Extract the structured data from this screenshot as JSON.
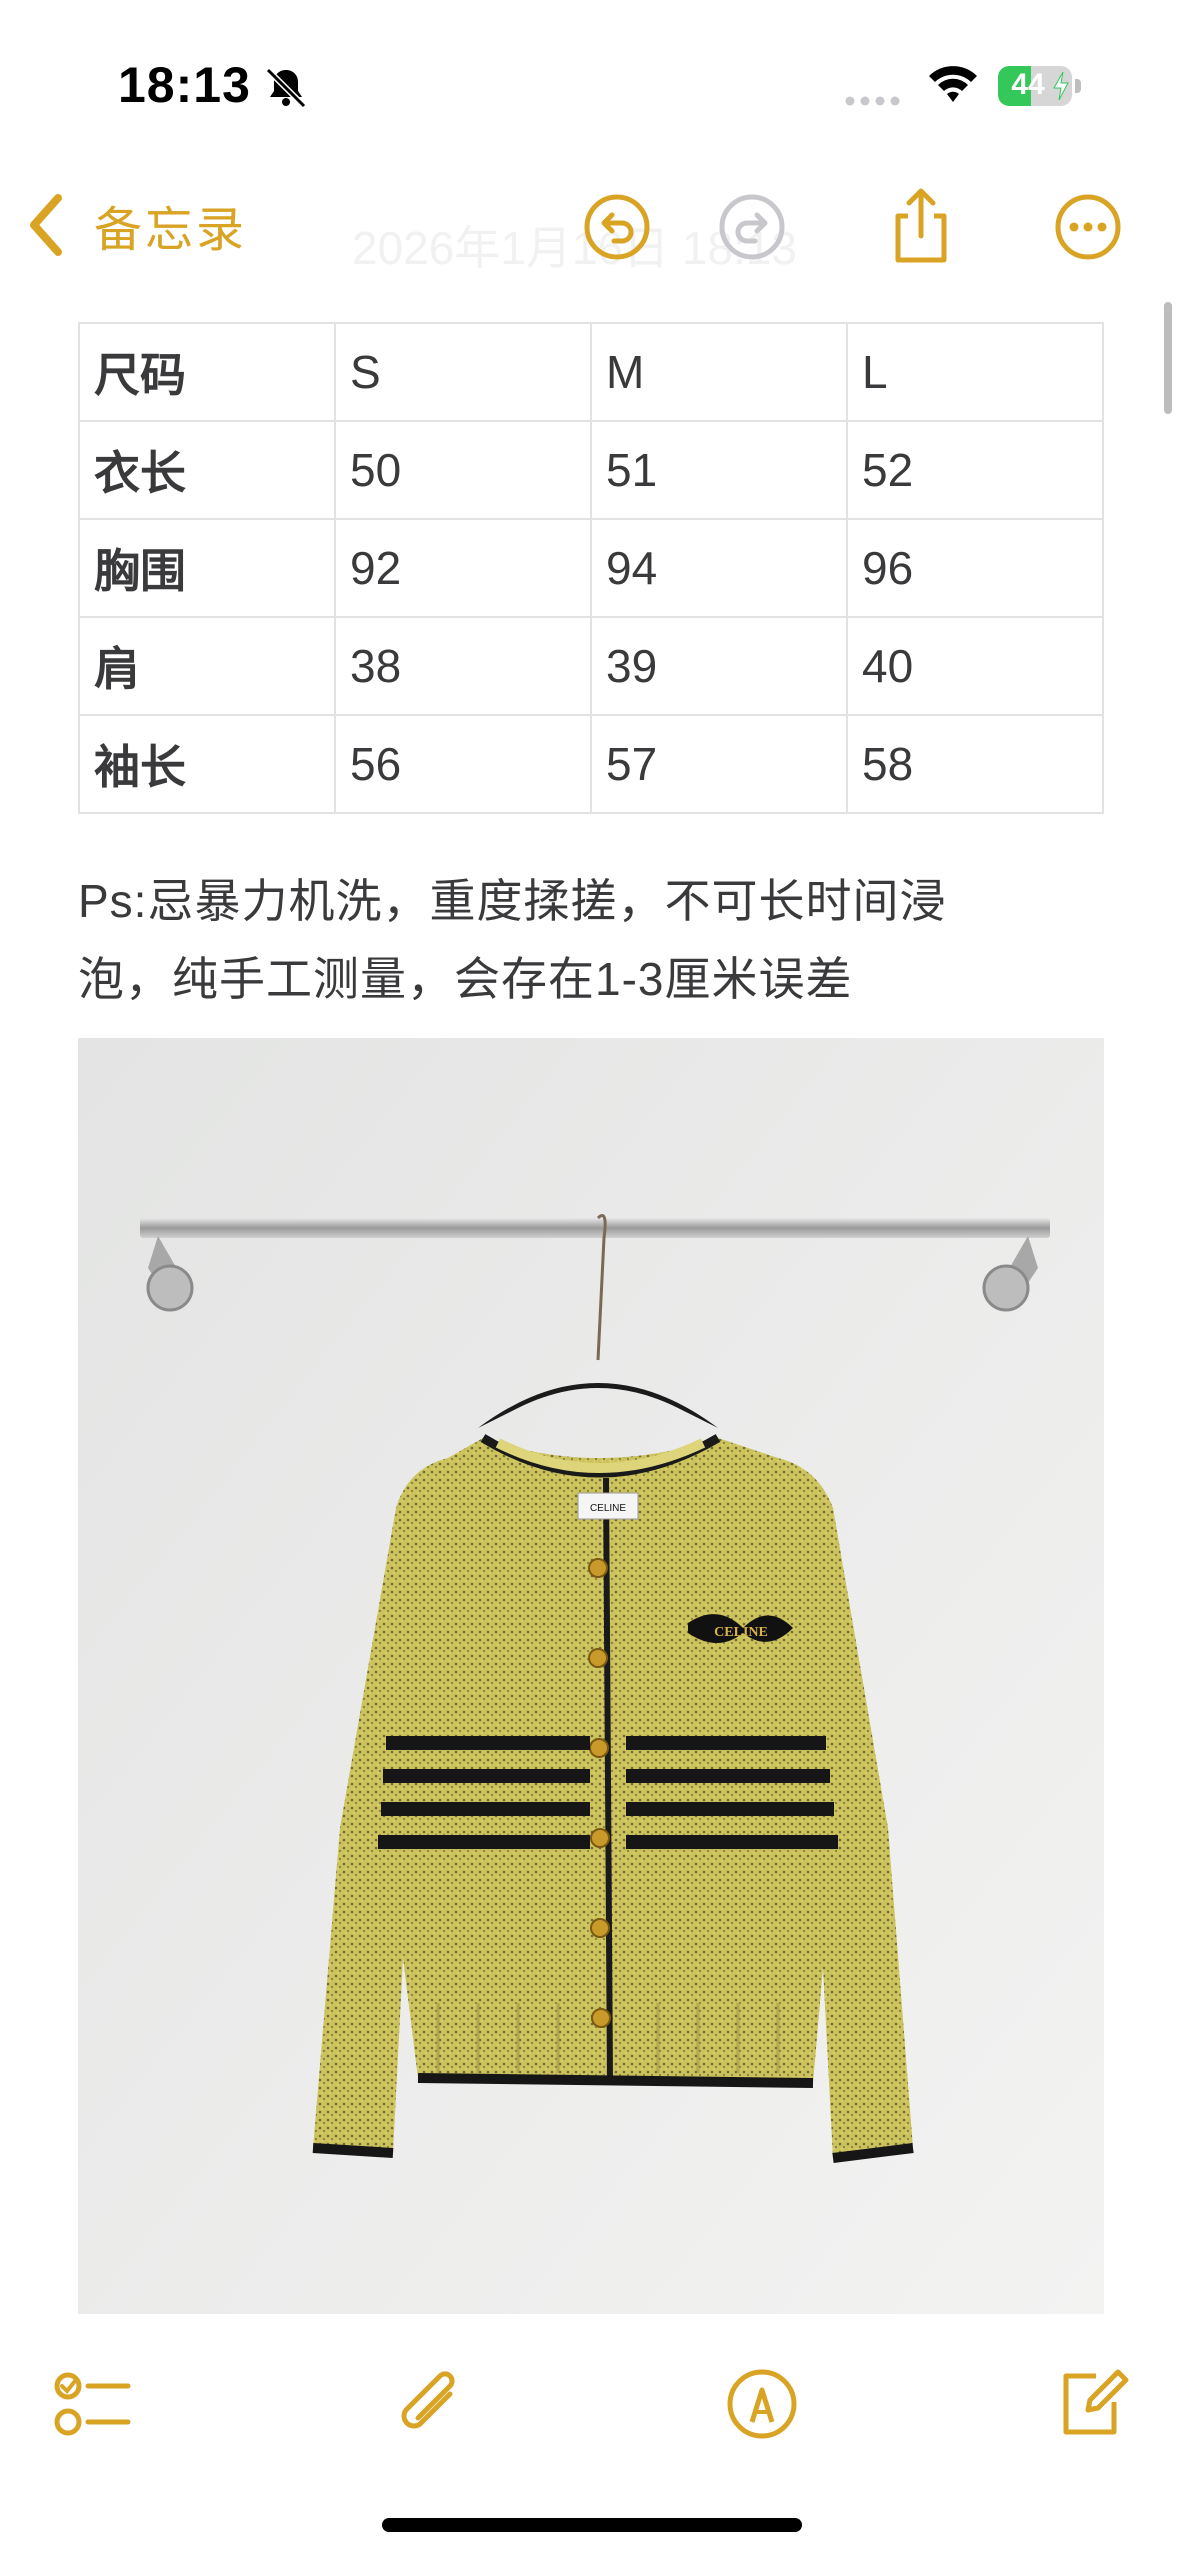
{
  "status_bar": {
    "time": "18:13",
    "battery": "44",
    "battery_level": 0.44
  },
  "nav": {
    "back_label": "备忘录",
    "faded_title": "2026年1月16日 18:13"
  },
  "table": {
    "header": [
      "尺码",
      "S",
      "M",
      "L"
    ],
    "rows": [
      [
        "衣长",
        "50",
        "51",
        "52"
      ],
      [
        "胸围",
        "92",
        "94",
        "96"
      ],
      [
        "肩",
        "38",
        "39",
        "40"
      ],
      [
        "袖长",
        "56",
        "57",
        "58"
      ]
    ]
  },
  "note": {
    "line1": "Ps:忌暴力机洗，重度揉搓，不可长时间浸",
    "line2": "泡，纯手工测量，会存在1-3厘米误差"
  },
  "image": {
    "garment_color": "#c9c15a",
    "logo": "CELINE",
    "label": "CELINE"
  },
  "colors": {
    "accent": "#d9a324"
  }
}
